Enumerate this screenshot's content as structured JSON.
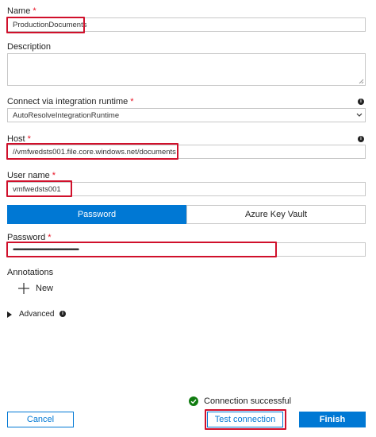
{
  "name": {
    "label": "Name",
    "required": "*",
    "value": "ProductionDocuments"
  },
  "description": {
    "label": "Description",
    "value": ""
  },
  "runtime": {
    "label": "Connect via integration runtime",
    "required": "*",
    "value": "AutoResolveIntegrationRuntime"
  },
  "host": {
    "label": "Host",
    "required": "*",
    "value": "//vmfwedsts001.file.core.windows.net/documents"
  },
  "username": {
    "label": "User name",
    "required": "*",
    "value": "vmfwedsts001"
  },
  "auth_toggle": {
    "password_label": "Password",
    "keyvault_label": "Azure Key Vault"
  },
  "password": {
    "label": "Password",
    "required": "*",
    "value": "••••••••••••••••••••••••••••••••••••••••••••••••••••••••••••••••••••••••••••••"
  },
  "annotations": {
    "label": "Annotations",
    "new_label": "New"
  },
  "advanced": {
    "label": "Advanced"
  },
  "status": {
    "text": "Connection successful"
  },
  "footer": {
    "cancel": "Cancel",
    "test_connection": "Test connection",
    "finish": "Finish"
  },
  "colors": {
    "accent": "#0078d4",
    "highlight": "#d0102b",
    "success": "#107c10"
  }
}
